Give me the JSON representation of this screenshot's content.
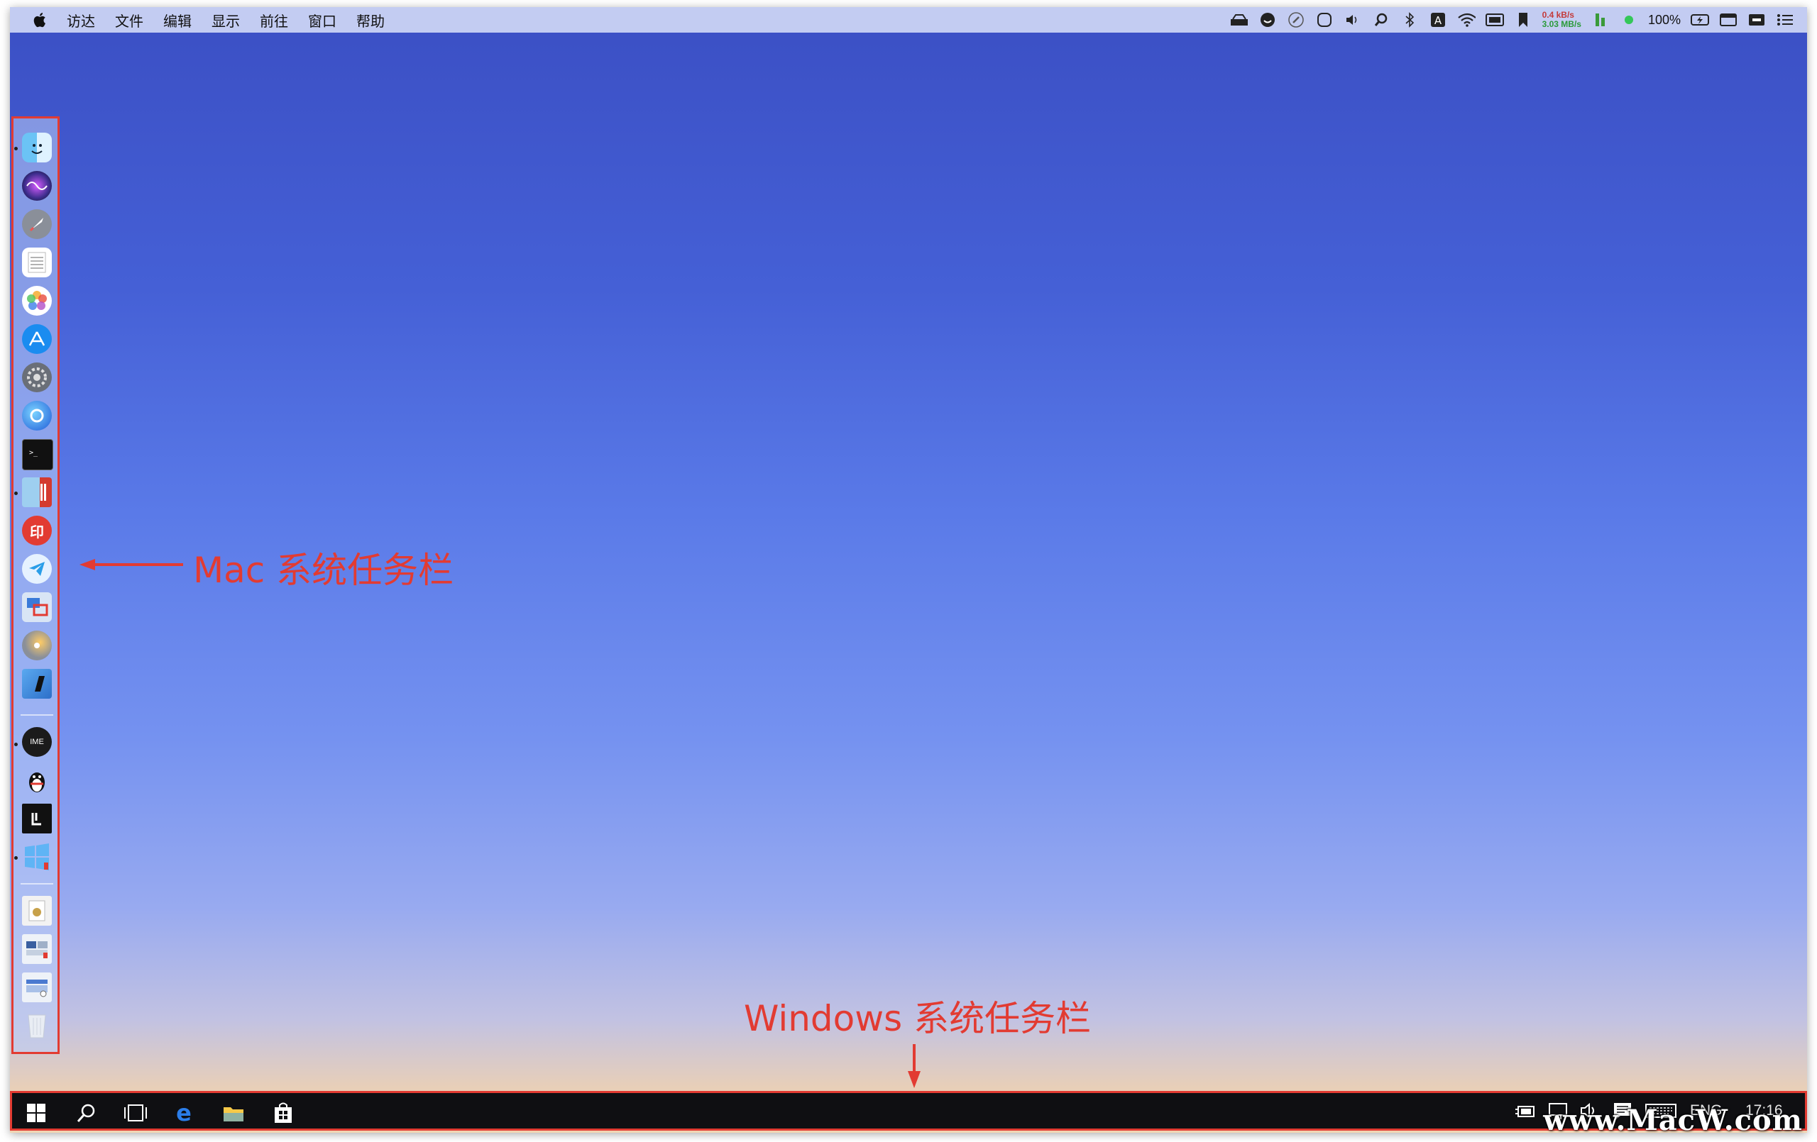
{
  "menubar": {
    "items": [
      "访达",
      "文件",
      "编辑",
      "显示",
      "前往",
      "窗口",
      "帮助"
    ],
    "net_up": "0.4 kB/s",
    "net_down": "3.03 MB/s",
    "battery_percent": "100%",
    "status_icons": [
      "wrench-box-icon",
      "smiley-icon",
      "pen-icon",
      "timer-icon",
      "volume-icon",
      "search-icon",
      "bluetooth-icon",
      "input-a-icon",
      "wifi-icon",
      "display-icon",
      "bookmark-icon",
      "memory-icon",
      "green-dot-icon",
      "battery-icon",
      "window-icon",
      "screen-icon",
      "list-icon"
    ]
  },
  "dock": {
    "apps": [
      "finder-icon",
      "siri-icon",
      "launchpad-icon",
      "notes-icon",
      "photos-icon",
      "app-store-icon",
      "system-preferences-icon",
      "firefox-icon",
      "terminal-icon",
      "parallels-icon",
      "pdf-tool-icon",
      "telegram-icon",
      "remote-desktop-icon",
      "disk-utility-icon",
      "xcode-icon",
      "ime-icon",
      "qq-icon",
      "typora-icon",
      "windows-icon",
      "archive-icon",
      "screenshot-icon",
      "display-settings-icon",
      "trash-icon"
    ],
    "ime_label": "IME",
    "pdf_label": "印"
  },
  "annotations": {
    "mac": "Mac 系统任务栏",
    "windows": "Windows 系统任务栏"
  },
  "taskbar": {
    "icons": [
      "windows-start-icon",
      "search-icon",
      "task-view-icon",
      "edge-icon",
      "file-explorer-icon",
      "store-icon"
    ],
    "tray_icons": [
      "battery-plug-icon",
      "network-icon",
      "volume-icon",
      "notification-icon",
      "keyboard-icon"
    ],
    "language": "ENG",
    "time": "17:16"
  },
  "watermark": "www.MacW.com",
  "colors": {
    "annotation_red": "#e23b32",
    "taskbar_bg": "#0f0f12"
  }
}
